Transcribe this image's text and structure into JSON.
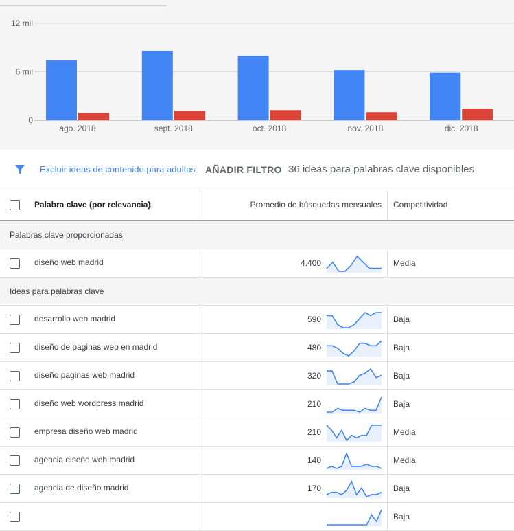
{
  "chart_data": {
    "type": "bar",
    "categories": [
      "ago. 2018",
      "sept. 2018",
      "oct. 2018",
      "nov. 2018",
      "dic. 2018"
    ],
    "series": [
      {
        "values": [
          7400,
          8600,
          8000,
          6200,
          5900
        ],
        "color": "#4285f4"
      },
      {
        "values": [
          900,
          1150,
          1250,
          1000,
          1450
        ],
        "color": "#db4437"
      }
    ],
    "yticks": [
      "0",
      "6 mil",
      "12 mil"
    ],
    "ylim": [
      0,
      12000
    ]
  },
  "filter_bar": {
    "exclude_link": "Excluir ideas de contenido para adultos",
    "add_filter": "AÑADIR FILTRO",
    "ideas_count": "36 ideas para palabras clave disponibles",
    "filter_icon": "filter-icon"
  },
  "table": {
    "headers": {
      "keyword": "Palabra clave (por relevancia)",
      "sort_icon": "arrow-down-icon",
      "avg": "Promedio de búsquedas mensuales",
      "competition": "Competitividad"
    },
    "section_provided": "Palabras clave proporcionadas",
    "section_ideas": "Ideas para palabras clave",
    "provided": [
      {
        "keyword": "diseño web madrid",
        "avg": "4.400",
        "competition": "Media",
        "trend": [
          2,
          4,
          1,
          1,
          3,
          6,
          4,
          2,
          2,
          2
        ]
      }
    ],
    "ideas": [
      {
        "keyword": "desarrollo web madrid",
        "avg": "590",
        "competition": "Baja",
        "trend": [
          5,
          5,
          2,
          1,
          1,
          2,
          4,
          6,
          5,
          6,
          6
        ]
      },
      {
        "keyword": "diseño de paginas web en madrid",
        "avg": "480",
        "competition": "Baja",
        "trend": [
          4,
          4,
          3,
          1,
          0,
          2,
          5,
          5,
          4,
          4,
          6
        ]
      },
      {
        "keyword": "diseño paginas web madrid",
        "avg": "320",
        "competition": "Baja",
        "trend": [
          7,
          7,
          1,
          1,
          1,
          2,
          5,
          6,
          8,
          4,
          5
        ]
      },
      {
        "keyword": "diseño web wordpress madrid",
        "avg": "210",
        "competition": "Baja",
        "trend": [
          1,
          1,
          3,
          2,
          2,
          2,
          1,
          3,
          2,
          2,
          9
        ]
      },
      {
        "keyword": "empresa diseño web madrid",
        "avg": "210",
        "competition": "Media",
        "trend": [
          6,
          4,
          1,
          4,
          0,
          2,
          1,
          2,
          2,
          6,
          6,
          6
        ]
      },
      {
        "keyword": "agencia diseño web madrid",
        "avg": "140",
        "competition": "Media",
        "trend": [
          1,
          2,
          1,
          2,
          8,
          2,
          2,
          2,
          3,
          2,
          2,
          1
        ]
      },
      {
        "keyword": "agencia de diseño madrid",
        "avg": "170",
        "competition": "Baja",
        "trend": [
          2,
          3,
          3,
          2,
          4,
          8,
          2,
          5,
          1,
          2,
          2,
          3
        ]
      },
      {
        "keyword": "",
        "avg": "",
        "competition": "Baja",
        "trend": [
          0,
          0,
          0,
          0,
          0,
          0,
          0,
          0,
          0,
          6,
          2,
          9
        ]
      }
    ]
  }
}
